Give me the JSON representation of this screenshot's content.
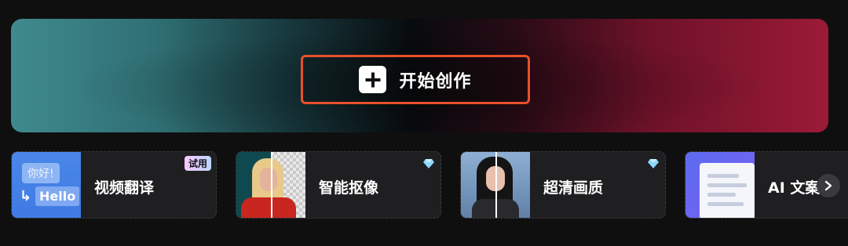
{
  "hero": {
    "create_label": "开始创作",
    "button_border_color": "#e8502c"
  },
  "tools": [
    {
      "label": "视频翻译",
      "badge": "试用",
      "thumb_text_cn": "你好!",
      "thumb_text_en": "Hello",
      "icon": "translate-icon"
    },
    {
      "label": "智能抠像",
      "badge_icon": "diamond-icon",
      "icon": "cutout-thumbnail"
    },
    {
      "label": "超清画质",
      "badge_icon": "diamond-icon",
      "icon": "hd-thumbnail"
    },
    {
      "label": "AI 文案",
      "icon": "ai-copy-thumbnail"
    }
  ],
  "carousel": {
    "next_icon": "chevron-right-icon"
  }
}
